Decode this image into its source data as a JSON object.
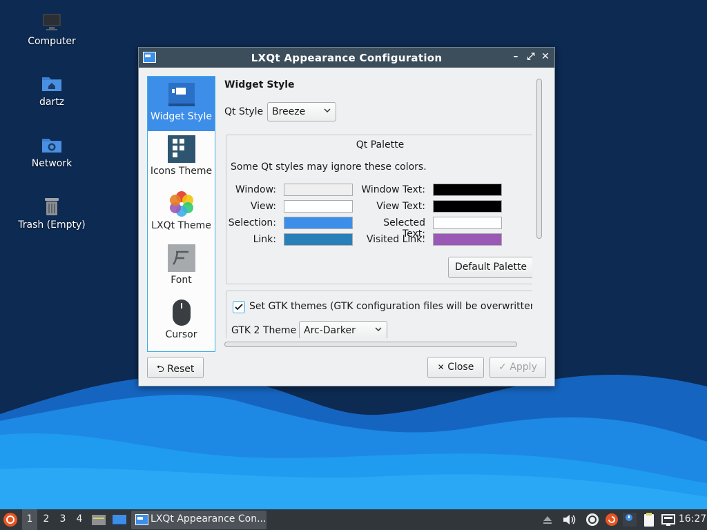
{
  "desktop": {
    "icons": [
      {
        "label": "Computer",
        "icon": "monitor-icon"
      },
      {
        "label": "dartz",
        "icon": "home-folder-icon"
      },
      {
        "label": "Network",
        "icon": "network-folder-icon"
      },
      {
        "label": "Trash (Empty)",
        "icon": "trash-icon"
      }
    ]
  },
  "window": {
    "title": "LXQt Appearance Configuration",
    "controls": {
      "minimize": "–",
      "maximize": "⤢",
      "close": "✕"
    },
    "sidebar": {
      "items": [
        {
          "label": "Widget Style",
          "icon": "widget-style-icon",
          "selected": true
        },
        {
          "label": "Icons Theme",
          "icon": "icons-theme-icon"
        },
        {
          "label": "LXQt Theme",
          "icon": "lxqt-theme-icon"
        },
        {
          "label": "Font",
          "icon": "font-icon"
        },
        {
          "label": "Cursor",
          "icon": "cursor-icon"
        }
      ]
    },
    "widget_style": {
      "heading": "Widget Style",
      "qt_style_label": "Qt Style",
      "qt_style_value": "Breeze",
      "palette": {
        "title": "Qt Palette",
        "note": "Some Qt styles may ignore these colors.",
        "left": [
          {
            "label": "Window:",
            "color": "#efefef"
          },
          {
            "label": "View:",
            "color": "#ffffff"
          },
          {
            "label": "Selection:",
            "color": "#3d8ee9"
          },
          {
            "label": "Link:",
            "color": "#2980b9"
          }
        ],
        "right": [
          {
            "label": "Window Text:",
            "color": "#000000"
          },
          {
            "label": "View Text:",
            "color": "#000000"
          },
          {
            "label": "Selected Text:",
            "color": "#ffffff"
          },
          {
            "label": "Visited Link:",
            "color": "#9b59b6"
          }
        ],
        "default_button": "Default Palette"
      },
      "gtk": {
        "checkbox_label": "Set GTK themes (GTK configuration files will be overwritten!)",
        "checked": true,
        "gtk2_label": "GTK 2 Theme",
        "gtk2_value": "Arc-Darker"
      }
    },
    "buttons": {
      "reset": "Reset",
      "close": "Close",
      "apply": "Apply"
    }
  },
  "taskbar": {
    "desktops": [
      "1",
      "2",
      "3",
      "4"
    ],
    "active_desktop": "1",
    "task_label": "LXQt Appearance Con...",
    "clock": "16:27"
  },
  "colors": {
    "desktop_bg": "#0d2a52",
    "accent": "#3daee9",
    "titlebar": "#3c4d5c",
    "taskbar": "#31363b"
  }
}
